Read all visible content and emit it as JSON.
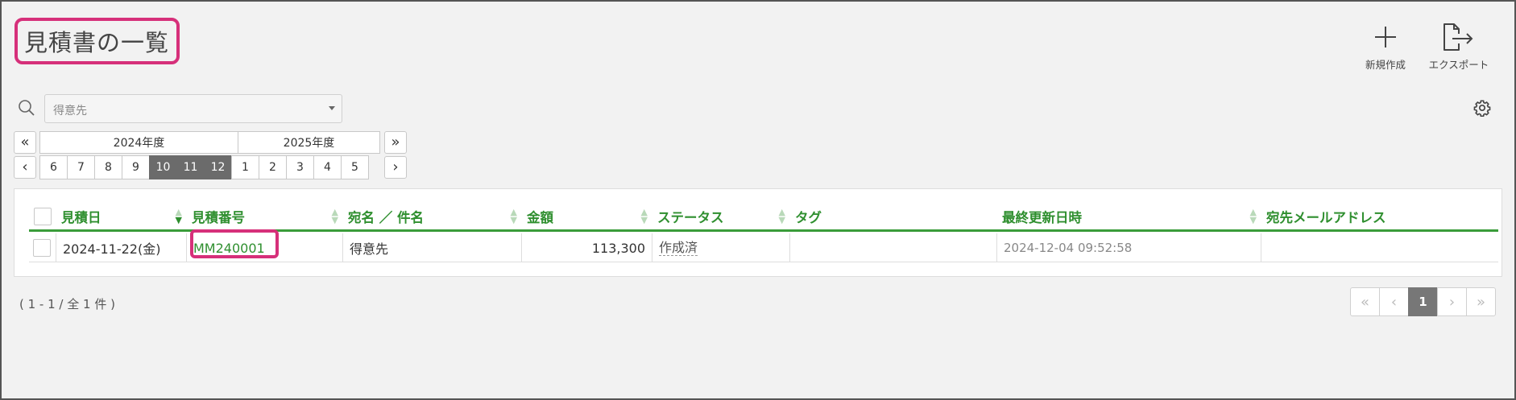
{
  "page": {
    "title": "見積書の一覧"
  },
  "toolbar": {
    "new_label": "新規作成",
    "export_label": "エクスポート"
  },
  "search": {
    "placeholder": "得意先"
  },
  "period": {
    "prev_year": "«",
    "next_year": "»",
    "prev_month": "‹",
    "next_month": "›",
    "years": [
      "2024年度",
      "2025年度"
    ],
    "months": [
      "6",
      "7",
      "8",
      "9",
      "10",
      "11",
      "12",
      "1",
      "2",
      "3",
      "4",
      "5"
    ],
    "selected_months": [
      "10",
      "11",
      "12"
    ]
  },
  "table": {
    "columns": [
      "見積日",
      "見積番号",
      "宛名 ／ 件名",
      "金額",
      "ステータス",
      "タグ",
      "最終更新日時",
      "宛先メールアドレス"
    ],
    "rows": [
      {
        "date": "2024-11-22(金)",
        "number": "MM240001",
        "recipient": "得意先",
        "amount": "113,300",
        "status": "作成済",
        "tag": "",
        "updated": "2024-12-04 09:52:58",
        "email": ""
      }
    ]
  },
  "footer": {
    "count": "( 1 - 1 / 全 1 件 )",
    "pagination": {
      "first": "«",
      "prev": "‹",
      "current": "1",
      "next": "›",
      "last": "»"
    }
  },
  "colors": {
    "accent": "#2f8f2f",
    "highlight": "#d6307a",
    "selected": "#6b6b6b"
  },
  "icons": [
    "plus-icon",
    "file-export-icon",
    "search-icon",
    "gear-icon"
  ]
}
